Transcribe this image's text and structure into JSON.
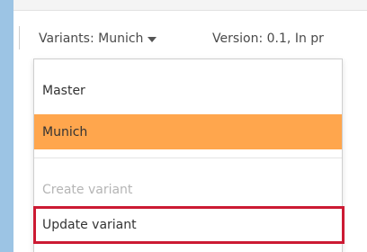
{
  "toolbar": {
    "variants_label": "Variants: Munich",
    "version_text": "Version: 0.1, In pr"
  },
  "menu": {
    "items": [
      {
        "label": "Master",
        "selected": false,
        "disabled": false
      },
      {
        "label": "Munich",
        "selected": true,
        "disabled": false
      },
      {
        "label": "Create variant",
        "selected": false,
        "disabled": true
      },
      {
        "label": "Update variant",
        "selected": false,
        "disabled": false,
        "highlighted": true
      }
    ]
  },
  "colors": {
    "background": "#9cc4e4",
    "selected_item": "#ffa64d",
    "highlight_border": "#cc1a33",
    "disabled_text": "#b5b5b5"
  },
  "icons": {
    "variants_dropdown": "caret-down-icon"
  }
}
